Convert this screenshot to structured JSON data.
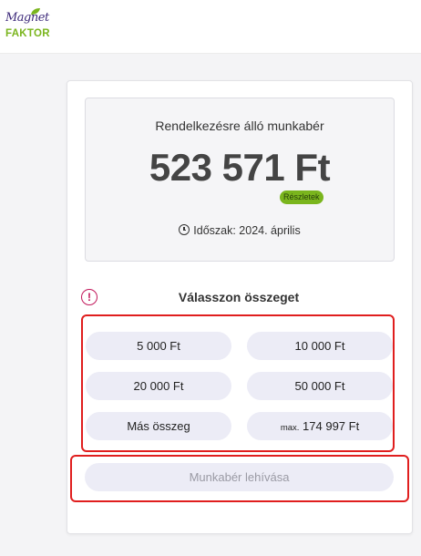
{
  "brand": {
    "logo_line1": "Magnet",
    "logo_line2": "FAKTOR",
    "colors": {
      "primary": "#3d2a7a",
      "accent": "#7ab51d",
      "alert": "#c2185b",
      "highlight": "#e01e1e"
    }
  },
  "balance": {
    "title": "Rendelkezésre álló munkabér",
    "amount": "523 571  Ft",
    "details_badge": "Részletek",
    "period_icon": "clock-icon",
    "period": "Időszak: 2024. április"
  },
  "selection": {
    "warning_icon": "exclamation-circle-icon",
    "title": "Válasszon összeget",
    "options": [
      {
        "label": "5 000  Ft"
      },
      {
        "label": "10 000  Ft"
      },
      {
        "label": "20 000  Ft"
      },
      {
        "label": "50 000  Ft"
      },
      {
        "label": "Más összeg"
      },
      {
        "prefix": "max.",
        "label": "174 997  Ft"
      }
    ]
  },
  "action": {
    "withdraw_label": "Munkabér lehívása"
  }
}
